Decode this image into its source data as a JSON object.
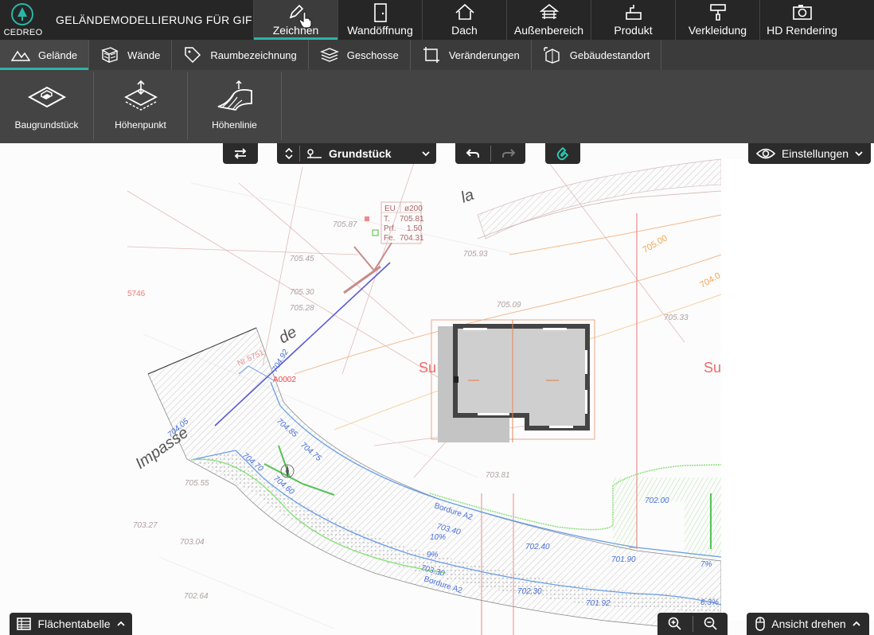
{
  "app": {
    "brand": "CEDREO",
    "title": "GELÄNDEMODELLIERUNG FÜR GIF"
  },
  "menu": [
    {
      "label": "Zeichnen",
      "icon": "pencil-icon"
    },
    {
      "label": "Wandöffnung",
      "icon": "door-icon"
    },
    {
      "label": "Dach",
      "icon": "roof-icon"
    },
    {
      "label": "Außenbereich",
      "icon": "outdoor-icon"
    },
    {
      "label": "Produkt",
      "icon": "product-icon"
    },
    {
      "label": "Verkleidung",
      "icon": "paint-roller-icon"
    },
    {
      "label": "HD Rendering",
      "icon": "camera-icon"
    }
  ],
  "subtabs": [
    {
      "label": "Gelände",
      "icon": "terrain-icon"
    },
    {
      "label": "Wände",
      "icon": "wall-icon"
    },
    {
      "label": "Raumbezeichnung",
      "icon": "tag-icon"
    },
    {
      "label": "Geschosse",
      "icon": "layers-icon"
    },
    {
      "label": "Veränderungen",
      "icon": "transform-icon"
    },
    {
      "label": "Gebäudestandort",
      "icon": "building-location-icon"
    }
  ],
  "tools": [
    {
      "label": "Baugrundstück",
      "icon": "plot-icon"
    },
    {
      "label": "Höhenpunkt",
      "icon": "height-point-icon"
    },
    {
      "label": "Höhenlinie",
      "icon": "contour-line-icon"
    }
  ],
  "toolbar": {
    "level_label": "Grundstück",
    "settings_label": "Einstellungen",
    "area_table_label": "Flächentabelle",
    "rotate_view_label": "Ansicht drehen"
  },
  "plan": {
    "street_fragments": [
      "Impasse",
      "de",
      "la"
    ],
    "parcel_labels": [
      "5746",
      "Su",
      "Su"
    ],
    "red_labels": [
      "Nr 5751",
      "A0002"
    ],
    "contour_labels": [
      "705.00",
      "704.0"
    ],
    "elevations": [
      "705.81",
      "1.50",
      "704.31",
      "705.87",
      "705.45",
      "705.30",
      "705.28",
      "704.92",
      "704.85",
      "704.75",
      "704.70",
      "704.60",
      "704.05",
      "703.40",
      "703.30",
      "702.40",
      "702.30",
      "702.00",
      "701.90",
      "701.92",
      "705.93",
      "705.09",
      "705.33",
      "703.81",
      "703.27",
      "703.04",
      "702.64",
      "705.55"
    ],
    "table": {
      "eu": "EU",
      "diam": "ø200",
      "t": "T.",
      "pr": "Prf.",
      "fe": "Fe."
    },
    "borders": [
      "Bordure A2",
      "Bordure A2"
    ],
    "percents": [
      "10%",
      "9%",
      "7%",
      "6.3%"
    ]
  }
}
